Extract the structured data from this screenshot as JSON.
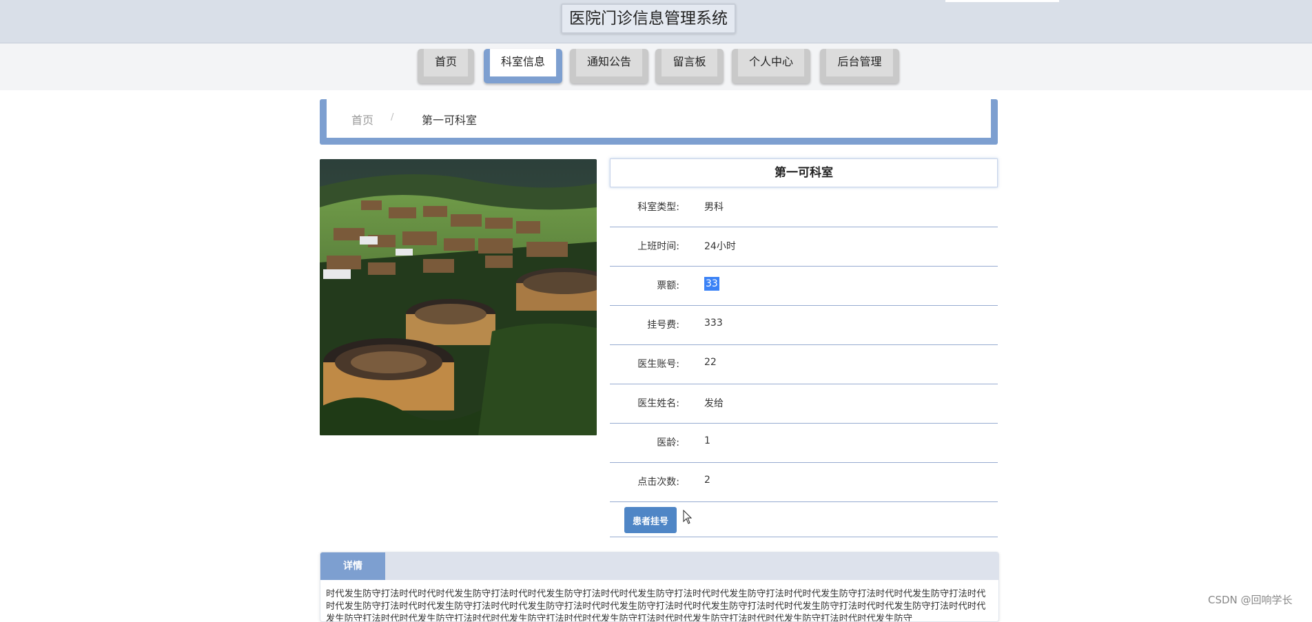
{
  "header": {
    "title": "医院门诊信息管理系统"
  },
  "nav": {
    "items": [
      {
        "label": "首页"
      },
      {
        "label": "科室信息"
      },
      {
        "label": "通知公告"
      },
      {
        "label": "留言板"
      },
      {
        "label": "个人中心"
      },
      {
        "label": "后台管理"
      }
    ],
    "active": "科室信息"
  },
  "breadcrumb": {
    "home": "首页",
    "separator": "/",
    "current": "第一可科室"
  },
  "detail": {
    "title": "第一可科室",
    "fields": [
      {
        "label": "科室类型:",
        "value": "男科"
      },
      {
        "label": "上班时间:",
        "value": "24小时"
      },
      {
        "label": "票额:",
        "value": "33"
      },
      {
        "label": "挂号费:",
        "value": "333"
      },
      {
        "label": "医生账号:",
        "value": "22"
      },
      {
        "label": "医生姓名:",
        "value": "发给"
      },
      {
        "label": "医龄:",
        "value": "1"
      },
      {
        "label": "点击次数:",
        "value": "2"
      }
    ],
    "register_button": "患者挂号"
  },
  "tabs": {
    "detail_label": "详情",
    "content": "时代发生防守打法时代时代时代发生防守打法时代时代发生防守打法时代时代发生防守打法时代时代发生防守打法时代时代发生防守打法时代时代发生防守打法时代时代发生防守打法时代时代发生防守打法时代时代发生防守打法时代时代发生防守打法时代时代发生防守打法时代时代发生防守打法时代时代发生防守打法时代时代发生防守打法时代时代发生防守打法时代时代发生防守打法时代时代发生防守打法时代时代发生防守打法时代时代发生防守打法时代时代发生防守"
  },
  "watermark": "CSDN @回响学长",
  "colors": {
    "accent": "#7d9fd0",
    "button": "#4f86c6",
    "selection": "#3b82f6",
    "header_bg": "#d9dfe8"
  }
}
